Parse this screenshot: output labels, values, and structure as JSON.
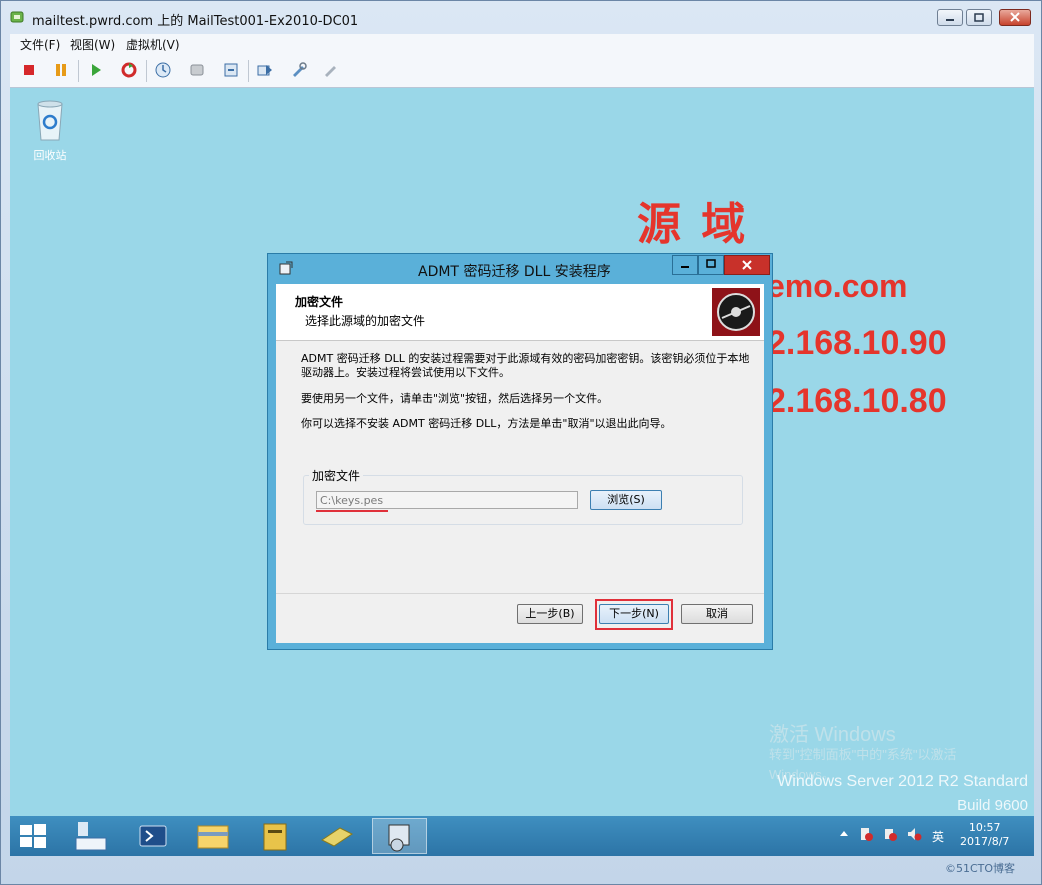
{
  "window": {
    "title": "mailtest.pwrd.com 上的 MailTest001-Ex2010-DC01"
  },
  "menu": [
    "文件(F)",
    "视图(W)",
    "虚拟机(V)"
  ],
  "desktop": {
    "recycle_bin_label": "回收站",
    "overlay": {
      "heading": "源 域",
      "line1": "emo.com",
      "line2": "2.168.10.90",
      "line3": "2.168.10.80"
    },
    "activation": {
      "line1": "激活 Windows",
      "line2": "转到\"控制面板\"中的\"系统\"以激活",
      "line3": "Windows。",
      "edition": "Windows Server 2012 R2 Standard",
      "build": "Build 9600"
    }
  },
  "dialog": {
    "title": "ADMT 密码迁移 DLL 安装程序",
    "header_title": "加密文件",
    "header_subtitle": "选择此源域的加密文件",
    "para1": "ADMT 密码迁移 DLL 的安装过程需要对于此源域有效的密码加密密钥。该密钥必须位于本地驱动器上。安装过程将尝试使用以下文件。",
    "para2": "要使用另一个文件，请单击\"浏览\"按钮，然后选择另一个文件。",
    "para3": "你可以选择不安装 ADMT 密码迁移 DLL，方法是单击\"取消\"以退出此向导。",
    "group_label": "加密文件",
    "file_path": "C:\\keys.pes",
    "browse_label": "浏览(S)",
    "back_label": "上一步(B)",
    "next_label": "下一步(N)",
    "cancel_label": "取消"
  },
  "taskbar": {
    "ime": "英",
    "time": "10:57",
    "date": "2017/8/7"
  },
  "watermark": "©51CTO博客"
}
